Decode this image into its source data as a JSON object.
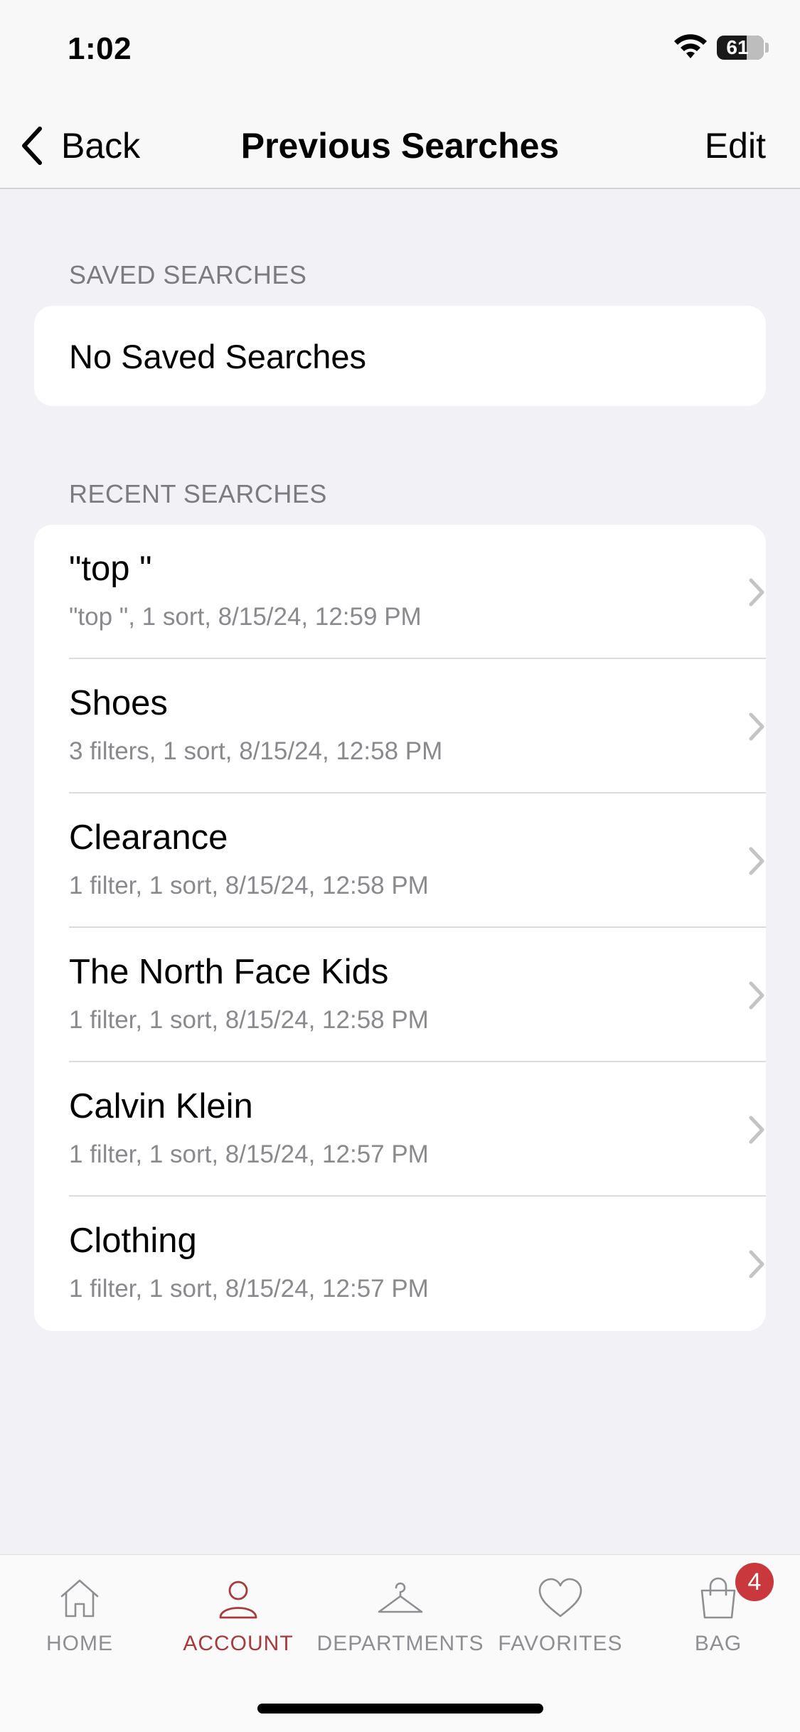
{
  "status_bar": {
    "time": "1:02",
    "battery": "61"
  },
  "nav": {
    "back_label": "Back",
    "title": "Previous Searches",
    "edit_label": "Edit"
  },
  "saved": {
    "header": "SAVED SEARCHES",
    "empty_text": "No Saved Searches"
  },
  "recent": {
    "header": "RECENT SEARCHES",
    "items": [
      {
        "title": "\"top \"",
        "subtitle": "\"top \", 1 sort, 8/15/24, 12:59 PM"
      },
      {
        "title": "Shoes",
        "subtitle": "3 filters, 1 sort, 8/15/24, 12:58 PM"
      },
      {
        "title": "Clearance",
        "subtitle": "1 filter, 1 sort, 8/15/24, 12:58 PM"
      },
      {
        "title": "The North Face Kids",
        "subtitle": "1 filter, 1 sort, 8/15/24, 12:58 PM"
      },
      {
        "title": "Calvin Klein",
        "subtitle": "1 filter, 1 sort, 8/15/24, 12:57 PM"
      },
      {
        "title": "Clothing",
        "subtitle": "1 filter, 1 sort, 8/15/24, 12:57 PM"
      }
    ]
  },
  "tab_bar": {
    "tabs": [
      {
        "label": "HOME",
        "icon": "house-icon"
      },
      {
        "label": "ACCOUNT",
        "icon": "person-icon"
      },
      {
        "label": "DEPARTMENTS",
        "icon": "hanger-icon"
      },
      {
        "label": "FAVORITES",
        "icon": "heart-icon"
      },
      {
        "label": "BAG",
        "icon": "shopping-bag-icon"
      }
    ],
    "active": "ACCOUNT",
    "bag_badge": "4"
  },
  "colors": {
    "accent": "#a83a3c",
    "badge": "#c8383c",
    "background": "#f1f1f6"
  }
}
